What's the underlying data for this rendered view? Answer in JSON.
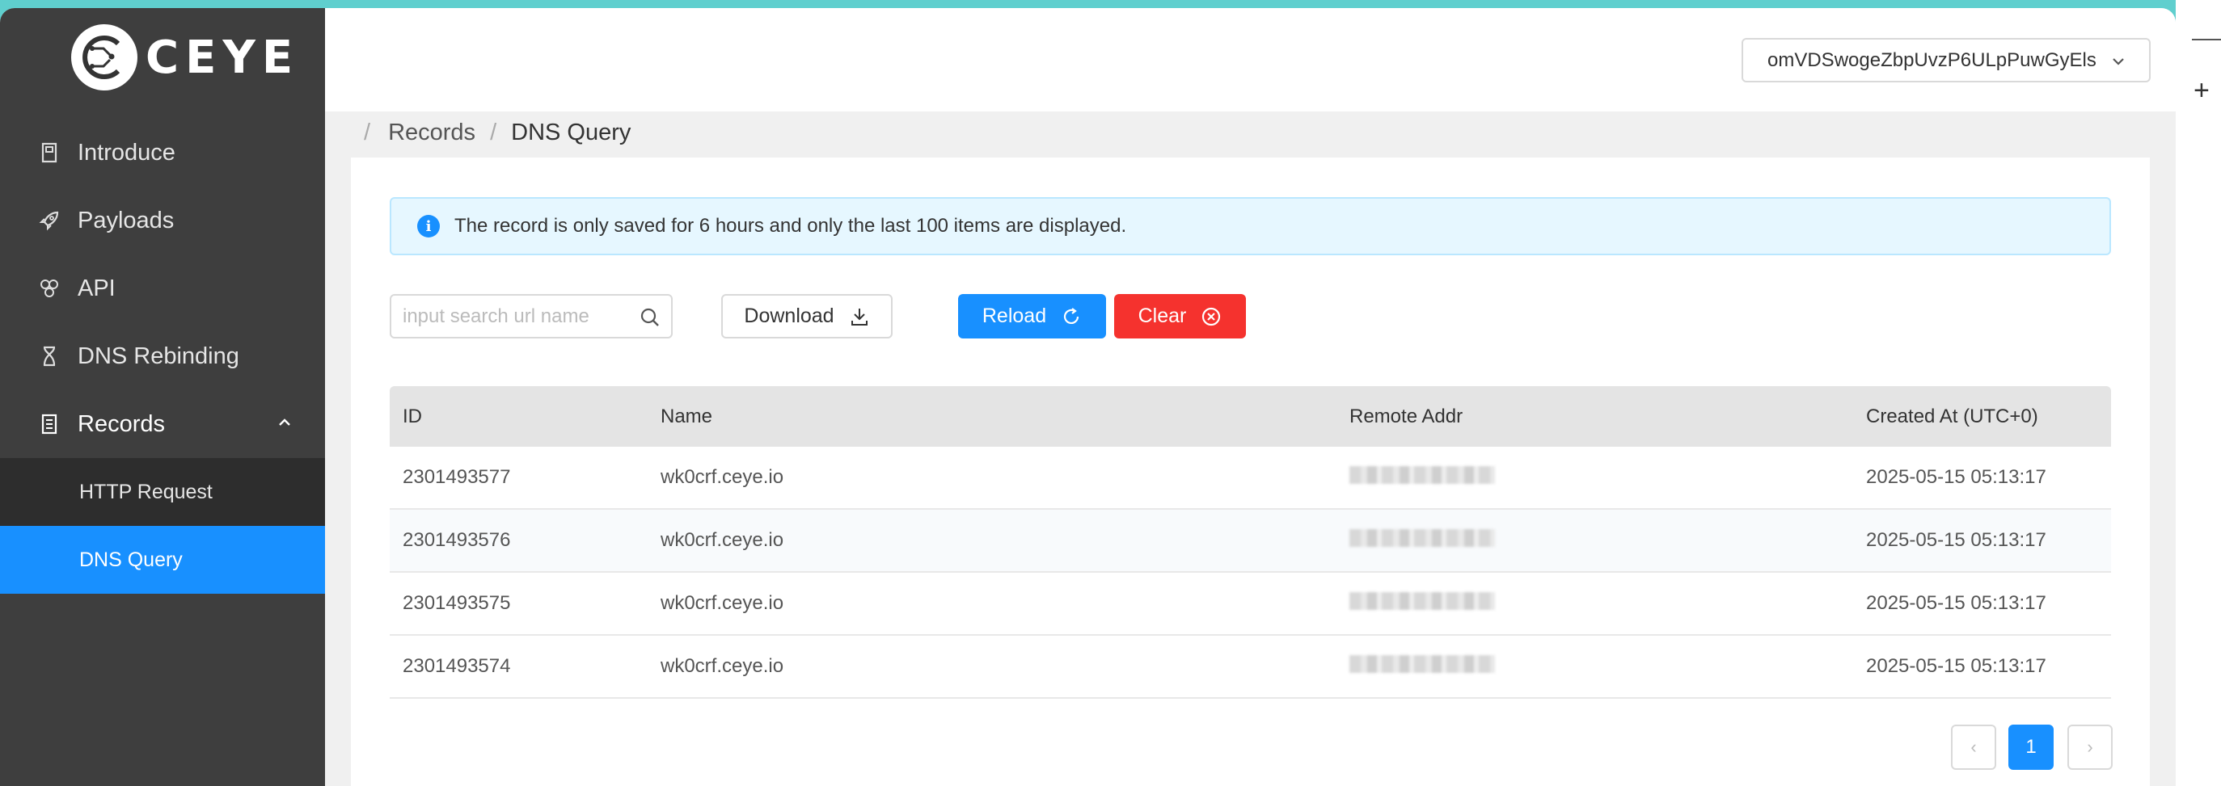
{
  "brand": {
    "name": "CEYE"
  },
  "sidebar": {
    "items": [
      {
        "label": "Introduce",
        "icon": "book-icon"
      },
      {
        "label": "Payloads",
        "icon": "rocket-icon"
      },
      {
        "label": "API",
        "icon": "api-icon"
      },
      {
        "label": "DNS Rebinding",
        "icon": "hourglass-icon"
      },
      {
        "label": "Records",
        "icon": "file-icon",
        "expanded": true
      }
    ],
    "submenu": [
      {
        "label": "HTTP Request"
      },
      {
        "label": "DNS Query",
        "active": true
      }
    ]
  },
  "header": {
    "user": "omVDSwogeZbpUvzP6ULpPuwGyEls"
  },
  "breadcrumb": {
    "items": [
      "Records",
      "DNS Query"
    ]
  },
  "alert": {
    "text": "The record is only saved for 6 hours and only the last 100 items are displayed."
  },
  "toolbar": {
    "search_placeholder": "input search url name",
    "download_label": "Download",
    "reload_label": "Reload",
    "clear_label": "Clear"
  },
  "table": {
    "columns": [
      "ID",
      "Name",
      "Remote Addr",
      "Created At (UTC+0)"
    ],
    "rows": [
      {
        "id": "2301493577",
        "name": "wk0crf.ceye.io",
        "created": "2025-05-15 05:13:17"
      },
      {
        "id": "2301493576",
        "name": "wk0crf.ceye.io",
        "created": "2025-05-15 05:13:17"
      },
      {
        "id": "2301493575",
        "name": "wk0crf.ceye.io",
        "created": "2025-05-15 05:13:17"
      },
      {
        "id": "2301493574",
        "name": "wk0crf.ceye.io",
        "created": "2025-05-15 05:13:17"
      }
    ]
  },
  "pagination": {
    "current": "1",
    "prev": "‹",
    "next": "›"
  },
  "colors": {
    "accent": "#1890ff",
    "danger": "#f5322e",
    "sidebar": "#3e3e3e"
  }
}
